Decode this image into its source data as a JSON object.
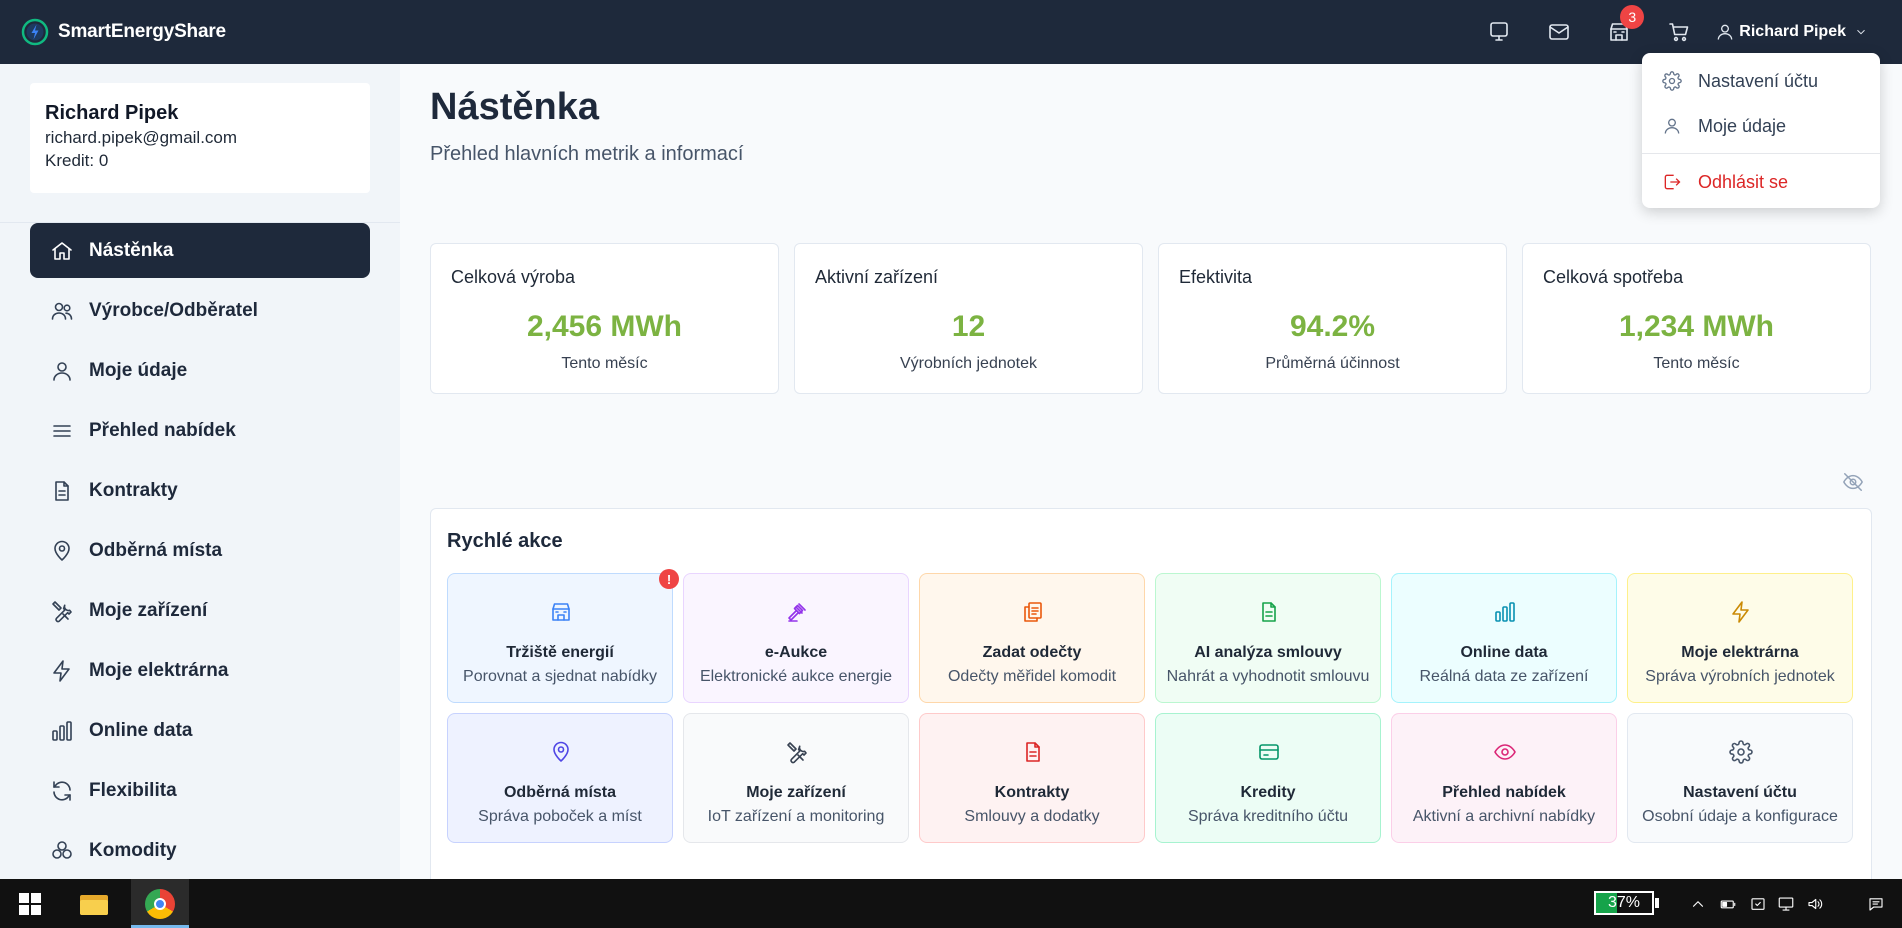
{
  "app": {
    "name": "SmartEnergyShare"
  },
  "topbar": {
    "icons": [
      "monitor-icon",
      "mail-icon",
      "store-icon",
      "cart-icon"
    ],
    "store_badge": "3",
    "user_name": "Richard Pipek"
  },
  "user_menu": {
    "items": [
      {
        "label": "Nastavení účtu",
        "icon": "gear-icon"
      },
      {
        "label": "Moje údaje",
        "icon": "user-icon"
      },
      {
        "label": "Odhlásit se",
        "icon": "logout-icon"
      }
    ]
  },
  "sidebar": {
    "user": {
      "name": "Richard Pipek",
      "email": "richard.pipek@gmail.com",
      "credit": "Kredit: 0"
    },
    "items": [
      {
        "label": "Nástěnka",
        "icon": "home-icon",
        "active": true
      },
      {
        "label": "Výrobce/Odběratel",
        "icon": "users-icon"
      },
      {
        "label": "Moje údaje",
        "icon": "user-icon"
      },
      {
        "label": "Přehled nabídek",
        "icon": "list-icon"
      },
      {
        "label": "Kontrakty",
        "icon": "document-icon"
      },
      {
        "label": "Odběrná místa",
        "icon": "map-pin-icon"
      },
      {
        "label": "Moje zařízení",
        "icon": "tools-icon"
      },
      {
        "label": "Moje elektrárna",
        "icon": "bolt-icon"
      },
      {
        "label": "Online data",
        "icon": "bar-chart-icon"
      },
      {
        "label": "Flexibilita",
        "icon": "refresh-icon"
      },
      {
        "label": "Komodity",
        "icon": "cubes-icon"
      }
    ]
  },
  "main": {
    "title": "Nástěnka",
    "subtitle": "Přehled hlavních metrik a informací",
    "stats": [
      {
        "label": "Celková výroba",
        "value": "2,456 MWh",
        "note": "Tento měsíc"
      },
      {
        "label": "Aktivní zařízení",
        "value": "12",
        "note": "Výrobních jednotek"
      },
      {
        "label": "Efektivita",
        "value": "94.2%",
        "note": "Průměrná účinnost"
      },
      {
        "label": "Celková spotřeba",
        "value": "1,234 MWh",
        "note": "Tento měsíc"
      }
    ],
    "quick_actions": {
      "title": "Rychlé akce",
      "items": [
        {
          "title": "Tržiště energií",
          "subtitle": "Porovnat a sjednat nabídky",
          "icon": "store-icon",
          "badge": "!",
          "color": "#3b82f6",
          "bg": "#eff6ff",
          "border": "#bfdbfe"
        },
        {
          "title": "e-Aukce",
          "subtitle": "Elektronické aukce energie",
          "icon": "gavel-icon",
          "color": "#9333ea",
          "bg": "#faf5ff",
          "border": "#e9d5ff"
        },
        {
          "title": "Zadat odečty",
          "subtitle": "Odečty měřidel komodit",
          "icon": "copy-icon",
          "color": "#ea580c",
          "bg": "#fff7ed",
          "border": "#fed7aa"
        },
        {
          "title": "AI analýza smlouvy",
          "subtitle": "Nahrát a vyhodnotit smlouvu",
          "icon": "document-icon",
          "color": "#16a34a",
          "bg": "#f0fdf4",
          "border": "#bbf7d0"
        },
        {
          "title": "Online data",
          "subtitle": "Reálná data ze zařízení",
          "icon": "bar-chart-icon",
          "color": "#0891b2",
          "bg": "#ecfeff",
          "border": "#a5f3fc"
        },
        {
          "title": "Moje elektrárna",
          "subtitle": "Správa výrobních jednotek",
          "icon": "bolt-icon",
          "color": "#ca8a04",
          "bg": "#fefce8",
          "border": "#fef08a"
        },
        {
          "title": "Odběrná místa",
          "subtitle": "Správa poboček a míst",
          "icon": "map-pin-icon",
          "color": "#4f46e5",
          "bg": "#eef2ff",
          "border": "#c7d2fe"
        },
        {
          "title": "Moje zařízení",
          "subtitle": "IoT zařízení a monitoring",
          "icon": "tools-icon",
          "color": "#374151",
          "bg": "#f9fafb",
          "border": "#e5e7eb"
        },
        {
          "title": "Kontrakty",
          "subtitle": "Smlouvy a dodatky",
          "icon": "document-icon",
          "color": "#dc2626",
          "bg": "#fef2f2",
          "border": "#fecaca"
        },
        {
          "title": "Kredity",
          "subtitle": "Správa kreditního účtu",
          "icon": "credit-card-icon",
          "color": "#059669",
          "bg": "#ecfdf5",
          "border": "#a7f3d0"
        },
        {
          "title": "Přehled nabídek",
          "subtitle": "Aktivní a archivní nabídky",
          "icon": "eye-icon",
          "color": "#db2777",
          "bg": "#fdf2f8",
          "border": "#fbcfe8"
        },
        {
          "title": "Nastavení účtu",
          "subtitle": "Osobní údaje a konfigurace",
          "icon": "gear-icon",
          "color": "#475569",
          "bg": "#f8fafc",
          "border": "#e2e8f0"
        }
      ]
    }
  },
  "taskbar": {
    "battery": "37%",
    "battery_level": 0.37
  }
}
